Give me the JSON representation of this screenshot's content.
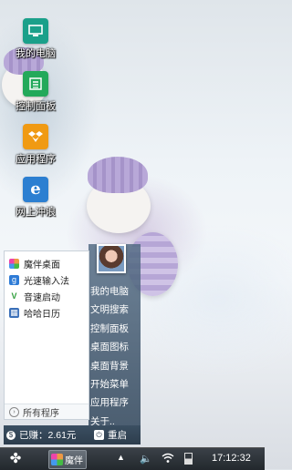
{
  "desktop": {
    "icons": [
      {
        "label": "我的电脑",
        "icon": "computer-icon",
        "color": "#1aa08a"
      },
      {
        "label": "控制面板",
        "icon": "control-panel-icon",
        "color": "#23a95a"
      },
      {
        "label": "应用程序",
        "icon": "apps-box-icon",
        "color": "#f09a13"
      },
      {
        "label": "网上冲浪",
        "icon": "ie-browser-icon",
        "color": "#2c7fd1"
      }
    ]
  },
  "start_menu": {
    "left_items": [
      {
        "label": "魔伴桌面",
        "icon": "mobanzhuomian-icon",
        "color": "#e9772a"
      },
      {
        "label": "光速输入法",
        "icon": "input-method-icon",
        "color": "#2e7bd6"
      },
      {
        "label": "音速启动",
        "icon": "launcher-icon",
        "color": "#2f9e3a"
      },
      {
        "label": "哈哈日历",
        "icon": "calendar-icon",
        "color": "#3a6fb8"
      }
    ],
    "all_programs": "所有程序",
    "right_items": [
      "我的电脑",
      "文明搜索",
      "控制面板",
      "桌面图标",
      "桌面背景",
      "开始菜单",
      "应用程序",
      "关于.."
    ],
    "earned": "已赚：2.61元",
    "restart": "重启"
  },
  "taskbar": {
    "app_label": "魔伴",
    "clock": "17:12:32"
  }
}
